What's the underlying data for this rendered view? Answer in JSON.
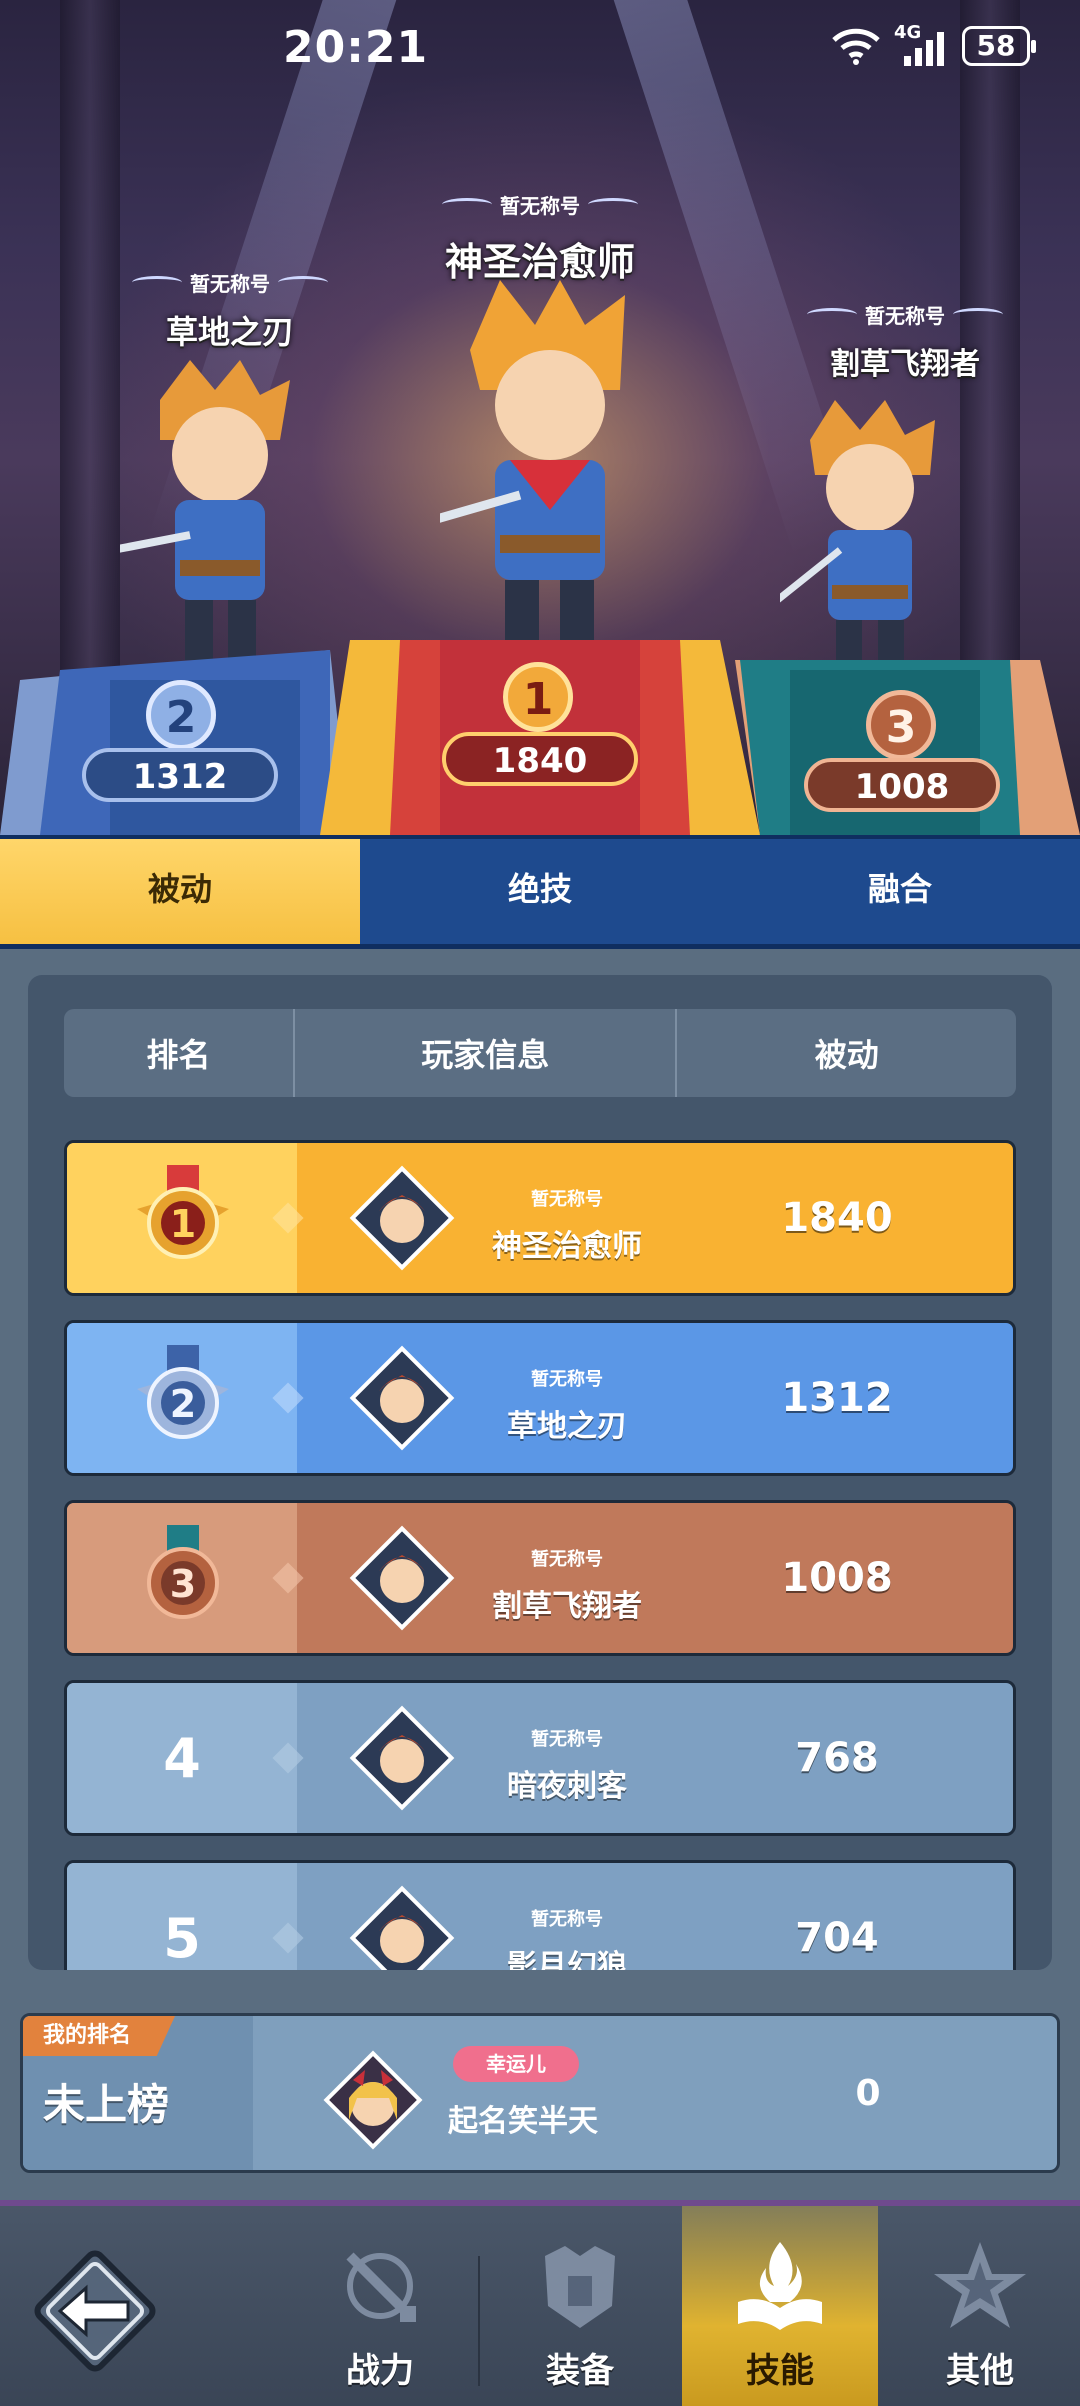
{
  "status_bar": {
    "time": "20:21",
    "network": "4G",
    "battery": "58"
  },
  "podium": [
    {
      "rank": "2",
      "title": "暂无称号",
      "name": "草地之刃",
      "score": "1312"
    },
    {
      "rank": "1",
      "title": "暂无称号",
      "name": "神圣治愈师",
      "score": "1840"
    },
    {
      "rank": "3",
      "title": "暂无称号",
      "name": "割草飞翔者",
      "score": "1008"
    }
  ],
  "tabs": [
    {
      "label": "被动",
      "active": true
    },
    {
      "label": "绝技",
      "active": false
    },
    {
      "label": "融合",
      "active": false
    }
  ],
  "table": {
    "headers": [
      "排名",
      "玩家信息",
      "被动"
    ],
    "rows": [
      {
        "rank": "1",
        "title": "暂无称号",
        "name": "神圣治愈师",
        "value": "1840"
      },
      {
        "rank": "2",
        "title": "暂无称号",
        "name": "草地之刃",
        "value": "1312"
      },
      {
        "rank": "3",
        "title": "暂无称号",
        "name": "割草飞翔者",
        "value": "1008"
      },
      {
        "rank": "4",
        "title": "暂无称号",
        "name": "暗夜刺客",
        "value": "768"
      },
      {
        "rank": "5",
        "title": "暂无称号",
        "name": "影月幻狼",
        "value": "704"
      }
    ]
  },
  "my_rank": {
    "tag": "我的排名",
    "status": "未上榜",
    "title": "幸运儿",
    "name": "起名笑半天",
    "value": "0"
  },
  "nav": [
    {
      "label": "战力",
      "icon": "sword-icon",
      "active": false
    },
    {
      "label": "装备",
      "icon": "armor-icon",
      "active": false
    },
    {
      "label": "技能",
      "icon": "book-flame-icon",
      "active": true
    },
    {
      "label": "其他",
      "icon": "star-icon",
      "active": false
    }
  ],
  "colors": {
    "gold": "#f6c042",
    "blue": "#5b97e6",
    "bronze": "#c0795b",
    "normal": "#7ea0c2",
    "tab_bar": "#1e4a8e"
  }
}
